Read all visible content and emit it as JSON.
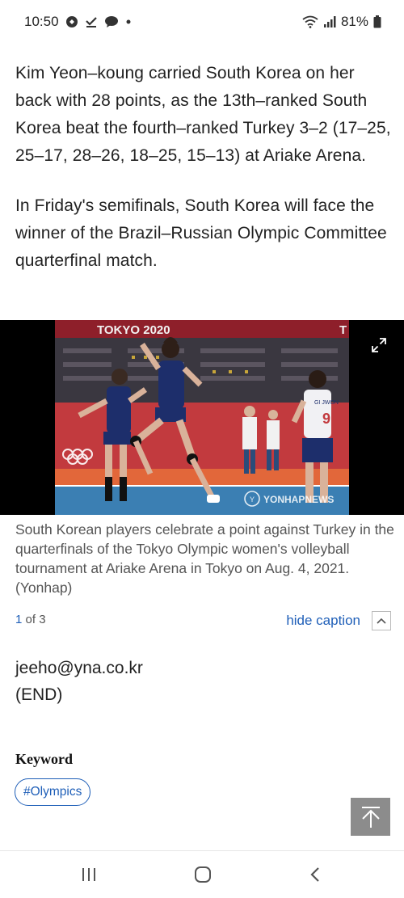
{
  "status": {
    "time": "10:50",
    "battery": "81%"
  },
  "article": {
    "paragraphs": [
      "Kim Yeon–koung carried South Korea on her back with 28 points, as the 13th–ranked South Korea beat the fourth–ranked Turkey 3–2 (17–25, 25–17, 28–26, 18–25, 15–13) at Ariake Arena.",
      "In Friday's semifinals, South Korea will face the winner of the Brazil–Russian Olympic Committee quarterfinal match."
    ]
  },
  "photo": {
    "banner_text": "TOKYO 2020",
    "watermark": "YONHAPNEWS",
    "jersey_name": "GI JWON",
    "jersey_number": "9",
    "caption": "South Korean players celebrate a point against Turkey in the quarterfinals of the Tokyo Olympic women's volleyball tournament at Ariake Arena in Tokyo on Aug. 4, 2021. (Yonhap)"
  },
  "pager": {
    "current": "1",
    "of_label": "of 3"
  },
  "hide_caption_label": "hide caption",
  "contact": {
    "email": "jeeho@yna.co.kr",
    "end": "(END)"
  },
  "keyword": {
    "title": "Keyword",
    "tags": [
      "#Olympics"
    ]
  },
  "colors": {
    "link": "#1f5fb8",
    "court_orange": "#e2673a",
    "court_blue": "#3b7fb3"
  }
}
